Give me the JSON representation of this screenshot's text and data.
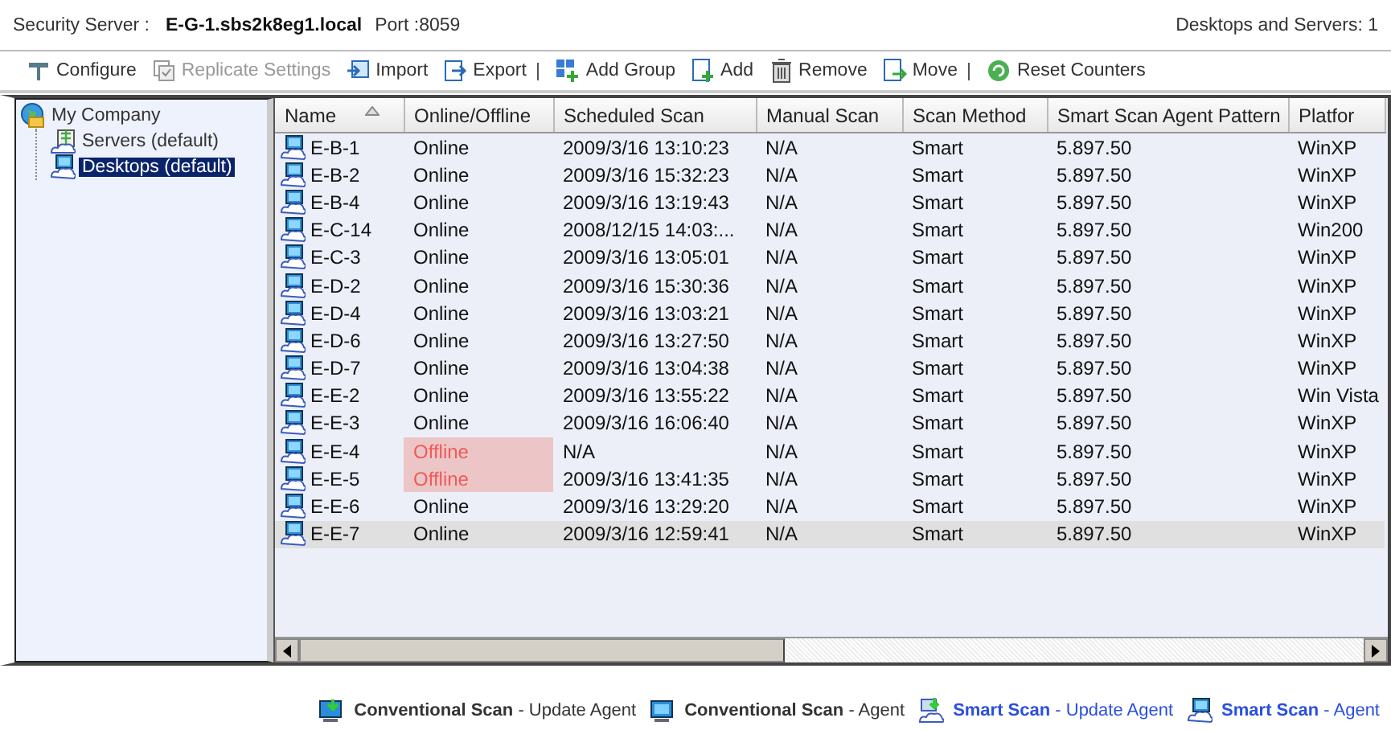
{
  "header": {
    "server_label": "Security Server :",
    "server_name": "E-G-1.sbs2k8eg1.local",
    "port": "Port :8059",
    "count": "Desktops and Servers: 1"
  },
  "toolbar": [
    {
      "kind": "button",
      "label": "Configure",
      "disabled": false
    },
    {
      "kind": "button",
      "label": "Replicate Settings",
      "disabled": true
    },
    {
      "kind": "button",
      "label": "Import",
      "disabled": false
    },
    {
      "kind": "button",
      "label": "Export",
      "disabled": false
    },
    {
      "kind": "separator"
    },
    {
      "kind": "button",
      "label": "Add Group",
      "disabled": false
    },
    {
      "kind": "button",
      "label": "Add",
      "disabled": false
    },
    {
      "kind": "button",
      "label": "Remove",
      "disabled": false
    },
    {
      "kind": "button",
      "label": "Move",
      "disabled": false
    },
    {
      "kind": "separator"
    },
    {
      "kind": "button",
      "label": "Reset Counters",
      "disabled": false
    }
  ],
  "tree": {
    "label": "My Company",
    "children": [
      {
        "label": "Servers (default)",
        "kind": "server",
        "selected": false
      },
      {
        "label": "Desktops (default)",
        "kind": "desktop",
        "selected": true
      }
    ]
  },
  "table": {
    "columns": [
      "Name",
      "Online/Offline",
      "Scheduled Scan",
      "Manual Scan",
      "Scan Method",
      "Smart Scan Agent Pattern",
      "Platfor"
    ],
    "rows": [
      {
        "cells": [
          "E-B-1",
          "Online",
          "2009/3/16 13:10:23",
          "N/A",
          "Smart",
          "5.897.50",
          "WinXP"
        ],
        "online": true,
        "selected": false
      },
      {
        "cells": [
          "E-B-2",
          "Online",
          "2009/3/16 15:32:23",
          "N/A",
          "Smart",
          "5.897.50",
          "WinXP"
        ],
        "online": true,
        "selected": false
      },
      {
        "cells": [
          "E-B-4",
          "Online",
          "2009/3/16 13:19:43",
          "N/A",
          "Smart",
          "5.897.50",
          "WinXP"
        ],
        "online": true,
        "selected": false
      },
      {
        "cells": [
          "E-C-14",
          "Online",
          "2008/12/15 14:03:...",
          "N/A",
          "Smart",
          "5.897.50",
          "Win200"
        ],
        "online": true,
        "selected": false
      },
      {
        "cells": [
          "E-C-3",
          "Online",
          "2009/3/16 13:05:01",
          "N/A",
          "Smart",
          "5.897.50",
          "WinXP"
        ],
        "online": true,
        "selected": false
      },
      {
        "cells": [
          "E-D-2",
          "Online",
          "2009/3/16 15:30:36",
          "N/A",
          "Smart",
          "5.897.50",
          "WinXP"
        ],
        "online": true,
        "selected": false
      },
      {
        "cells": [
          "E-D-4",
          "Online",
          "2009/3/16 13:03:21",
          "N/A",
          "Smart",
          "5.897.50",
          "WinXP"
        ],
        "online": true,
        "selected": false
      },
      {
        "cells": [
          "E-D-6",
          "Online",
          "2009/3/16 13:27:50",
          "N/A",
          "Smart",
          "5.897.50",
          "WinXP"
        ],
        "online": true,
        "selected": false
      },
      {
        "cells": [
          "E-D-7",
          "Online",
          "2009/3/16 13:04:38",
          "N/A",
          "Smart",
          "5.897.50",
          "WinXP"
        ],
        "online": true,
        "selected": false
      },
      {
        "cells": [
          "E-E-2",
          "Online",
          "2009/3/16 13:55:22",
          "N/A",
          "Smart",
          "5.897.50",
          "Win Vista"
        ],
        "online": true,
        "selected": false
      },
      {
        "cells": [
          "E-E-3",
          "Online",
          "2009/3/16 16:06:40",
          "N/A",
          "Smart",
          "5.897.50",
          "WinXP"
        ],
        "online": true,
        "selected": false
      },
      {
        "cells": [
          "E-E-4",
          "Offline",
          "N/A",
          "N/A",
          "Smart",
          "5.897.50",
          "WinXP"
        ],
        "online": false,
        "selected": false
      },
      {
        "cells": [
          "E-E-5",
          "Offline",
          "2009/3/16 13:41:35",
          "N/A",
          "Smart",
          "5.897.50",
          "WinXP"
        ],
        "online": false,
        "selected": false
      },
      {
        "cells": [
          "E-E-6",
          "Online",
          "2009/3/16 13:29:20",
          "N/A",
          "Smart",
          "5.897.50",
          "WinXP"
        ],
        "online": true,
        "selected": false
      },
      {
        "cells": [
          "E-E-7",
          "Online",
          "2009/3/16 12:59:41",
          "N/A",
          "Smart",
          "5.897.50",
          "WinXP"
        ],
        "online": true,
        "selected": true
      }
    ]
  },
  "legend": [
    {
      "kind": "conventional",
      "update": true,
      "text": "**Conventional Scan** - Update Agent"
    },
    {
      "kind": "conventional",
      "update": false,
      "text": "**Conventional Scan** - Agent"
    },
    {
      "kind": "smart",
      "update": true,
      "text": "**Smart Scan** - Update Agent"
    },
    {
      "kind": "smart",
      "update": false,
      "text": "**Smart Scan** - Agent"
    }
  ]
}
